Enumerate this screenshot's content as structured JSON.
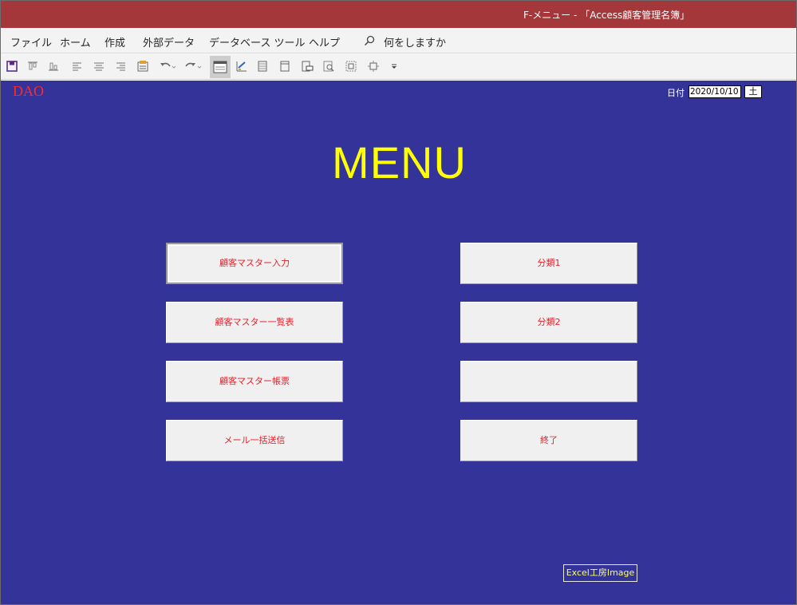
{
  "window": {
    "title": "F-メニュー - 「Access顧客管理名簿」"
  },
  "menubar": {
    "tabs": [
      "ファイル",
      "ホーム",
      "作成",
      "外部データ",
      "データベース ツール",
      "ヘルプ"
    ],
    "search_placeholder": "何をしますか"
  },
  "toolbar": {
    "icons": [
      "save-icon",
      "align-top-icon",
      "align-bottom-icon",
      "align-left-icon",
      "align-center-icon",
      "align-right-icon",
      "property-sheet-icon",
      "undo-icon",
      "redo-icon",
      "form-view-icon",
      "design-view-icon",
      "datasheet-icon",
      "blank-form-icon",
      "print-preview-icon",
      "zoom-icon",
      "select-all-icon",
      "size-to-fit-icon",
      "customize-dropdown-icon"
    ]
  },
  "form": {
    "logo_text": "DAO",
    "date_label": "日付",
    "date_value": "2020/10/10",
    "weekday_value": "土",
    "heading": "MENU",
    "buttons_left": [
      "顧客マスター入力",
      "顧客マスター一覧表",
      "顧客マスター帳票",
      "メール一括送信"
    ],
    "buttons_right": [
      "分類1",
      "分類2",
      "",
      "終了"
    ],
    "brand_label": "Excel工房Image"
  },
  "colors": {
    "titlebar": "#a4373a",
    "form_background": "#333399",
    "heading": "#ffff00",
    "button_text": "#e8202a",
    "logo": "#ff2a2a"
  }
}
